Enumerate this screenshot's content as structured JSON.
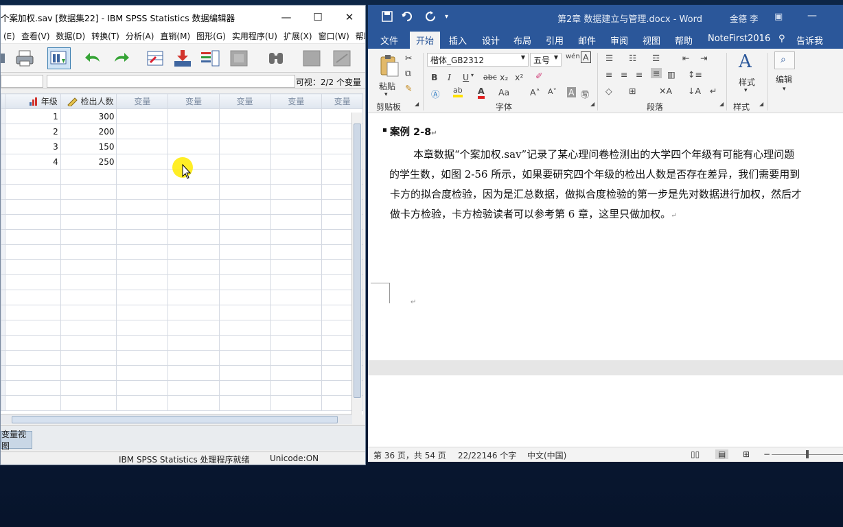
{
  "spss": {
    "title": "个案加权.sav [数据集22] - IBM SPSS Statistics 数据编辑器",
    "window_buttons": {
      "minimize": "—",
      "maximize": "☐",
      "close": "✕"
    },
    "menu": [
      "(E)",
      "查看(V)",
      "数据(D)",
      "转换(T)",
      "分析(A)",
      "直销(M)",
      "图形(G)",
      "实用程序(U)",
      "扩展(X)",
      "窗口(W)",
      "帮助(H)"
    ],
    "visible_vars": "可视：2/2 个变量",
    "columns": [
      "年级",
      "检出人数",
      "变量",
      "变量",
      "变量",
      "变量",
      "变量"
    ],
    "rows": [
      {
        "c1": "1",
        "c2": "300"
      },
      {
        "c1": "2",
        "c2": "200"
      },
      {
        "c1": "3",
        "c2": "150"
      },
      {
        "c1": "4",
        "c2": "250"
      }
    ],
    "view_tab": "变量视图",
    "status_processor": "IBM SPSS Statistics 处理程序就绪",
    "status_unicode": "Unicode:ON"
  },
  "word": {
    "doc_title": "第2章 数据建立与管理.docx  -  Word",
    "user": "金德 李",
    "tabs": [
      "文件",
      "开始",
      "插入",
      "设计",
      "布局",
      "引用",
      "邮件",
      "审阅",
      "视图",
      "帮助",
      "NoteFirst2016",
      "告诉我"
    ],
    "font_name": "楷体_GB2312",
    "font_size": "五号",
    "groups": {
      "clipboard": "剪贴板",
      "font": "字体",
      "paragraph": "段落",
      "styles": "样式"
    },
    "paste_label": "粘贴",
    "styles_label": "样式",
    "edit_label": "编辑",
    "heading": "案例 2-8",
    "para_lines": [
      "本章数据“个案加权.sav”记录了某心理问卷检测出的大学四个年级有可能有心理问题",
      "的学生数，如图 2-56 所示，如果要研究四个年级的检出人数是否存在差异，我们需要用到",
      "卡方的拟合度检验，因为是汇总数据，做拟合度检验的第一步是先对数据进行加权，然后才",
      "做卡方检验，卡方检验读者可以参考第 6 章，这里只做加权。"
    ],
    "status": {
      "page": "第 36 页，共 54 页",
      "words": "22/22146 个字",
      "lang": "中文(中国)"
    }
  },
  "colors": {
    "word_blue": "#2b579a",
    "highlight_yellow": "#ffeb00"
  }
}
